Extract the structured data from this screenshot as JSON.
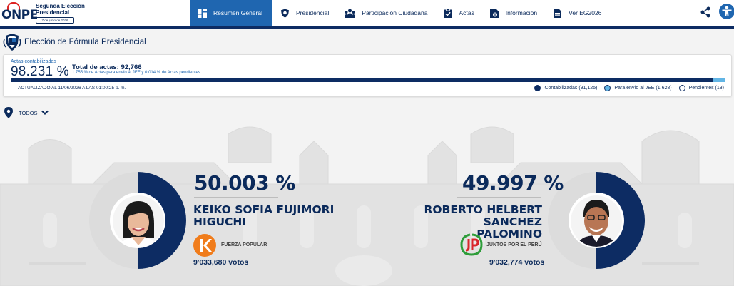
{
  "header": {
    "logo_text": "ONPE",
    "election_title": "Segunda Elección Presidencial",
    "election_date": "7 de junio de 2026",
    "nav": [
      {
        "label": "Resumen General",
        "icon": "dashboard-icon",
        "active": true
      },
      {
        "label": "Presidencial",
        "icon": "shield-icon",
        "active": false
      },
      {
        "label": "Participación Ciudadana",
        "icon": "people-icon",
        "active": false
      },
      {
        "label": "Actas",
        "icon": "clipboard-check-icon",
        "active": false
      },
      {
        "label": "Información",
        "icon": "info-document-icon",
        "active": false
      },
      {
        "label": "Ver EG2026",
        "icon": "document-icon",
        "active": false
      }
    ]
  },
  "section": {
    "title": "Elección de Fórmula Presidencial"
  },
  "stats": {
    "actas_label": "Actas contabilizadas",
    "actas_pct": "98.231 %",
    "actas_fraction": 0.98231,
    "jee_fraction": 0.01755,
    "total_label": "Total de actas:",
    "total_value": "92,766",
    "subnote": "1.755 % de Actas para envío al JEE y 0.014 % de Actas pendientes",
    "updated": "ACTUALIZADO AL 11/06/2026 A LAS 01:00:25 p. m.",
    "legend": [
      {
        "label": "Contabilizadas (91,125)",
        "type": "counted"
      },
      {
        "label": "Para envío al JEE (1,628)",
        "type": "jee"
      },
      {
        "label": "Pendientes (13)",
        "type": "pending"
      }
    ]
  },
  "filter": {
    "label": "TODOS"
  },
  "candidates": [
    {
      "pct": "50.003 %",
      "fraction": 0.50003,
      "name_line1": "KEIKO SOFIA FUJIMORI",
      "name_line2": "HIGUCHI",
      "party": "FUERZA POPULAR",
      "votes": "9'033,680 votos"
    },
    {
      "pct": "49.997 %",
      "fraction": 0.49997,
      "name_line1": "ROBERTO HELBERT SANCHEZ",
      "name_line2": "PALOMINO",
      "party": "JUNTOS POR EL PERÚ",
      "votes": "9'032,774 votos"
    }
  ],
  "colors": {
    "navy": "#0d2c63",
    "accent_blue": "#1f66b0",
    "light_blue": "#62b5e5",
    "fuerza_orange": "#f07c1b",
    "juntos_green": "#2e9d3a",
    "juntos_red": "#d9262c"
  }
}
